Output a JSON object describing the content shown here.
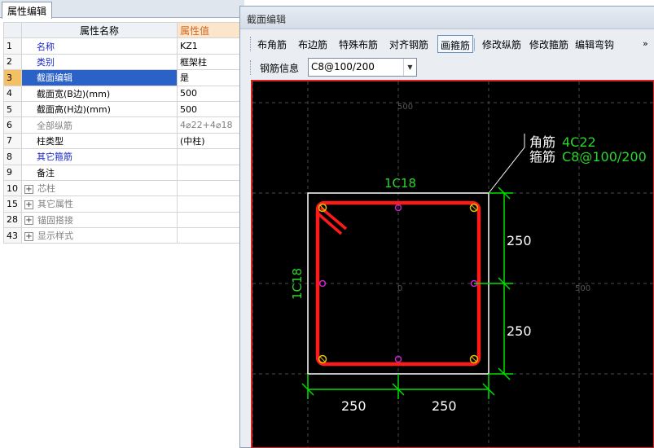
{
  "left_panel": {
    "tab": "属性编辑",
    "header_name": "属性名称",
    "header_value": "属性值",
    "rows": [
      {
        "num": "1",
        "name": "名称",
        "value": "KZ1",
        "style": "blue"
      },
      {
        "num": "2",
        "name": "类别",
        "value": "框架柱",
        "style": "blue"
      },
      {
        "num": "3",
        "name": "截面编辑",
        "value": "是",
        "style": "sel"
      },
      {
        "num": "4",
        "name": "截面宽(B边)(mm)",
        "value": "500",
        "style": "black"
      },
      {
        "num": "5",
        "name": "截面高(H边)(mm)",
        "value": "500",
        "style": "black"
      },
      {
        "num": "6",
        "name": "全部纵筋",
        "value": "4⌀22+4⌀18",
        "style": "gray"
      },
      {
        "num": "7",
        "name": "柱类型",
        "value": "(中柱)",
        "style": "black"
      },
      {
        "num": "8",
        "name": "其它箍筋",
        "value": "",
        "style": "blue"
      },
      {
        "num": "9",
        "name": "备注",
        "value": "",
        "style": "black"
      },
      {
        "num": "10",
        "name": "芯柱",
        "value": "",
        "style": "group"
      },
      {
        "num": "15",
        "name": "其它属性",
        "value": "",
        "style": "group"
      },
      {
        "num": "28",
        "name": "锚固搭接",
        "value": "",
        "style": "group"
      },
      {
        "num": "43",
        "name": "显示样式",
        "value": "",
        "style": "group"
      }
    ],
    "expand_glyph": "+"
  },
  "editor": {
    "title": "截面编辑",
    "toolbar": [
      "布角筋",
      "布边筋",
      "特殊布筋",
      "对齐钢筋",
      "画箍筋",
      "修改纵筋",
      "修改箍筋",
      "编辑弯钩"
    ],
    "active_tool": "画箍筋",
    "overflow": "»",
    "rebar_info_label": "钢筋信息",
    "rebar_info_value": "C8@100/200",
    "canvas": {
      "axis_labels": {
        "top": "500",
        "origin": "0",
        "right": "500"
      },
      "corner_label": "角筋",
      "corner_value": "4C22",
      "stirrup_label": "箍筋",
      "stirrup_value": "C8@100/200",
      "top_edge_label": "1C18",
      "left_edge_label": "1C18",
      "dim_right_upper": "250",
      "dim_right_lower": "250",
      "dim_bottom_left": "250",
      "dim_bottom_right": "250"
    },
    "colors": {
      "stirrup": "#ff1a1a",
      "dimension": "#00e000",
      "label_green": "#2bd62b",
      "outline": "#ffffff",
      "side_bar": "#d020d0",
      "corner_bar": "#e0c000",
      "frame_border": "#d62525"
    }
  }
}
